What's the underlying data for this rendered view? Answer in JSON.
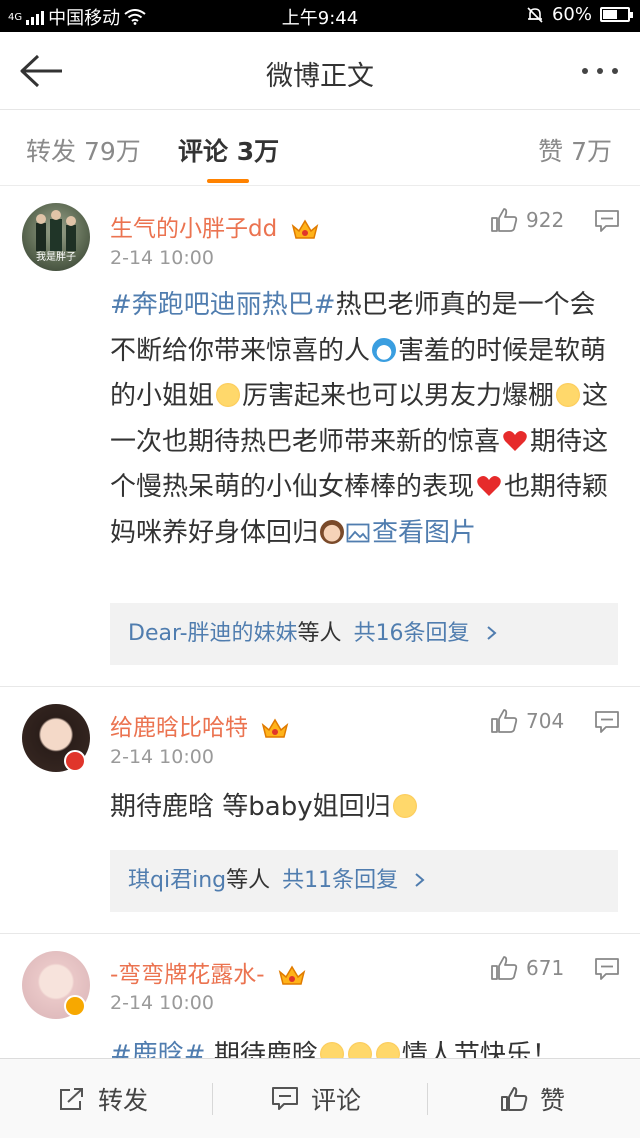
{
  "status_bar": {
    "network": "4G",
    "carrier": "中国移动",
    "time": "上午9:44",
    "battery_percent": 60,
    "battery_label": "60%"
  },
  "nav": {
    "title": "微博正文"
  },
  "tabs": {
    "repost": "转发 79万",
    "comment": "评论 3万",
    "like": "赞 7万"
  },
  "comments": [
    {
      "username": "生气的小胖子dd",
      "avatar_caption": "我是胖子",
      "time": "2-14 10:00",
      "likes": "922",
      "text_parts": {
        "topic": "#奔跑吧迪丽热巴#",
        "p1": "热巴老师真的是一个会不断给你带来惊喜的人",
        "p2": "害羞的时候是软萌的小姐姐",
        "p3": "厉害起来也可以男友力爆棚",
        "p4": "这一次也期待热巴老师带来新的惊喜",
        "p5": "期待这个慢热呆萌的小仙女棒棒的表现",
        "p6": "也期待颖妈咪养好身体回归",
        "view_image": "查看图片"
      },
      "replies_user": "Dear-胖迪的妹妹",
      "replies_suffix": "等人",
      "replies_count": "共16条回复"
    },
    {
      "username": "给鹿晗比哈特",
      "time": "2-14 10:00",
      "likes": "704",
      "text": "期待鹿晗 等baby姐回归",
      "replies_user": "琪qi君ing",
      "replies_suffix": "等人",
      "replies_count": "共11条回复"
    },
    {
      "username": "-弯弯牌花露水-",
      "time": "2-14 10:00",
      "likes": "671",
      "text_parts": {
        "topic": "#鹿晗#",
        "p1": " 期待鹿晗",
        "p2": "情人节快乐！"
      }
    }
  ],
  "bottom_bar": {
    "repost": "转发",
    "comment": "评论",
    "like": "赞"
  },
  "colors": {
    "accent": "#ff8200",
    "username": "#eb7350",
    "link": "#507daf"
  }
}
